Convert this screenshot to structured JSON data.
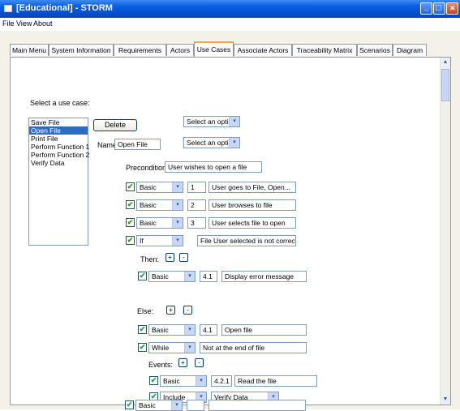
{
  "window": {
    "title": "[Educational] - STORM"
  },
  "menu": [
    "File",
    "View",
    "About"
  ],
  "tabs": [
    {
      "label": "Main Menu"
    },
    {
      "label": "System Information"
    },
    {
      "label": "Requirements"
    },
    {
      "label": "Actors"
    },
    {
      "label": "Use Cases",
      "active": true
    },
    {
      "label": "Associate Actors"
    },
    {
      "label": "Traceability Matrix"
    },
    {
      "label": "Scenarios"
    },
    {
      "label": "Diagram"
    }
  ],
  "usecase_panel": {
    "select_label": "Select a use case:",
    "use_cases": [
      "Save File",
      "Open File",
      "Print File",
      "Perform Function 1",
      "Perform Function 2",
      "Verify Data"
    ],
    "selected": "Open File",
    "delete_label": "Delete",
    "option1": "Select an option",
    "option2": "Select an option",
    "name_label": "Name:",
    "name_value": "Open File",
    "precondition_label": "Precondition:",
    "precondition_value": "User wishes to open a file"
  },
  "steps": [
    {
      "type": "Basic",
      "num": "1",
      "text": "User goes to File, Open..."
    },
    {
      "type": "Basic",
      "num": "2",
      "text": "User browses to file"
    },
    {
      "type": "Basic",
      "num": "3",
      "text": "User selects file to open"
    },
    {
      "type": "If",
      "num": "",
      "text": "File User selected is not correct format"
    }
  ],
  "then": {
    "label": "Then:",
    "steps": [
      {
        "type": "Basic",
        "num": "4.1",
        "text": "Display error message"
      }
    ]
  },
  "else": {
    "label": "Else:",
    "steps": [
      {
        "type": "Basic",
        "num": "4.1",
        "text": "Open file"
      },
      {
        "type": "While",
        "num": "",
        "text": "Not at the end of file"
      }
    ]
  },
  "events": {
    "label": "Events:",
    "steps": [
      {
        "type": "Basic",
        "num": "4.2.1",
        "text": "Read the file"
      }
    ],
    "include": {
      "type": "Include",
      "value": "Verify Data"
    }
  },
  "last_step": {
    "type": "Basic"
  },
  "glyphs": {
    "check": "✔",
    "arrow": "▾",
    "plus": "+",
    "minus": "-",
    "up": "▲",
    "down": "▼",
    "minimize": "_",
    "maximize": "□",
    "close": "✕"
  },
  "colors": {
    "title_bar": "#0450d6",
    "tab_highlight": "#f2a93b",
    "selection": "#316ac5",
    "check_green": "#21a121"
  }
}
